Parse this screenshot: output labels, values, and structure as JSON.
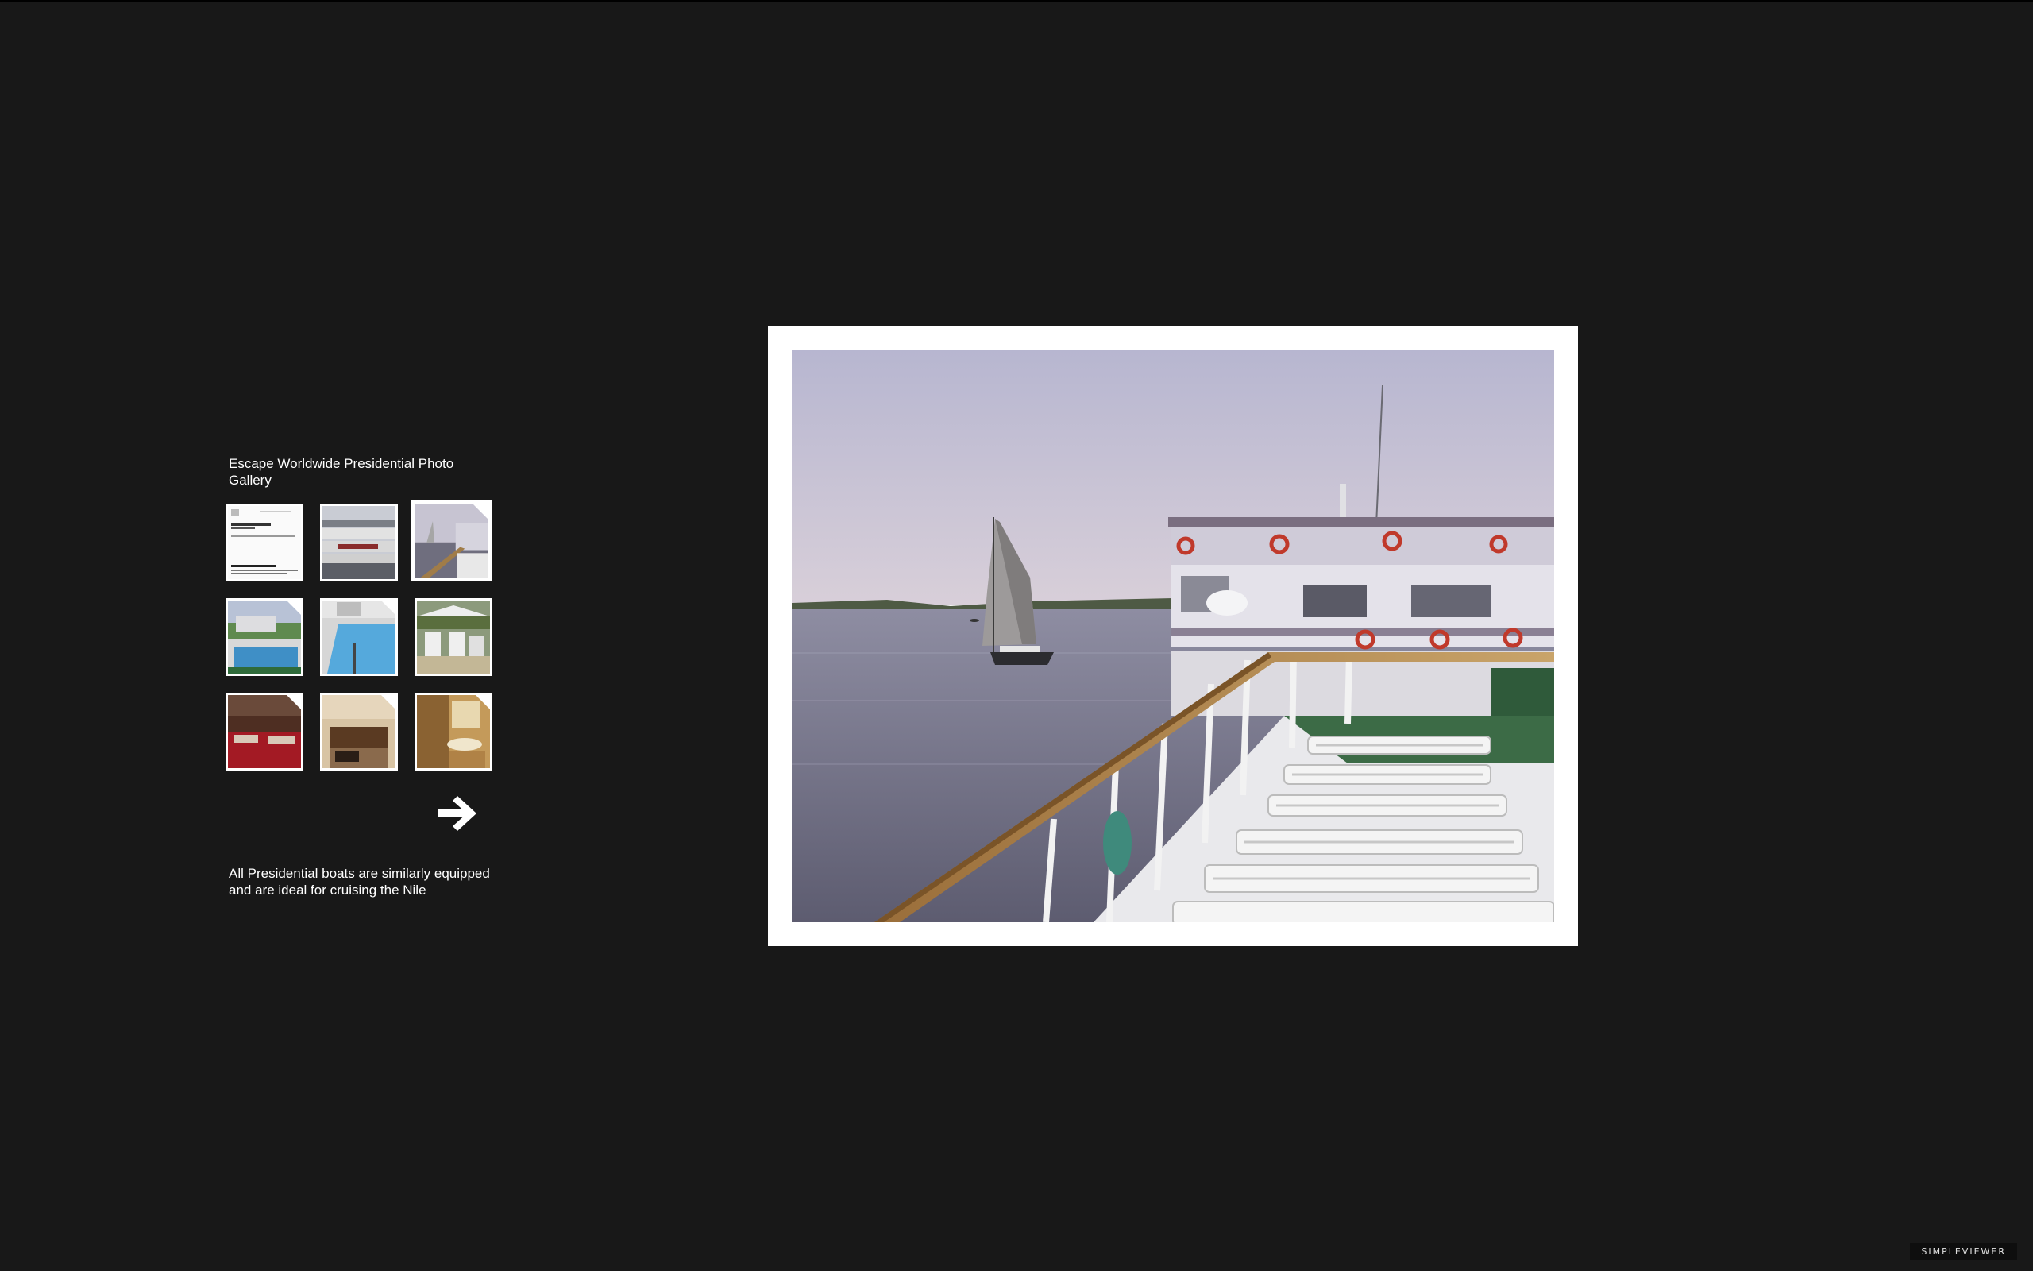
{
  "gallery": {
    "title": "Escape Worldwide Presidential Photo Gallery",
    "caption": "All Presidential boats are similarly equipped and are ideal for cruising the Nile",
    "selected_index": 2,
    "thumbnails": [
      {
        "subject": "brochure-page"
      },
      {
        "subject": "boat-exterior"
      },
      {
        "subject": "sun-deck-nile"
      },
      {
        "subject": "pool-deck"
      },
      {
        "subject": "swimming-pool"
      },
      {
        "subject": "deck-lounge"
      },
      {
        "subject": "restaurant"
      },
      {
        "subject": "cabin"
      },
      {
        "subject": "bathroom"
      }
    ],
    "next_icon": "arrow-right-icon"
  },
  "branding": {
    "label": "SIMPLEVIEWER"
  },
  "colors": {
    "background": "#181818",
    "frame": "#ffffff",
    "text": "#ffffff"
  }
}
